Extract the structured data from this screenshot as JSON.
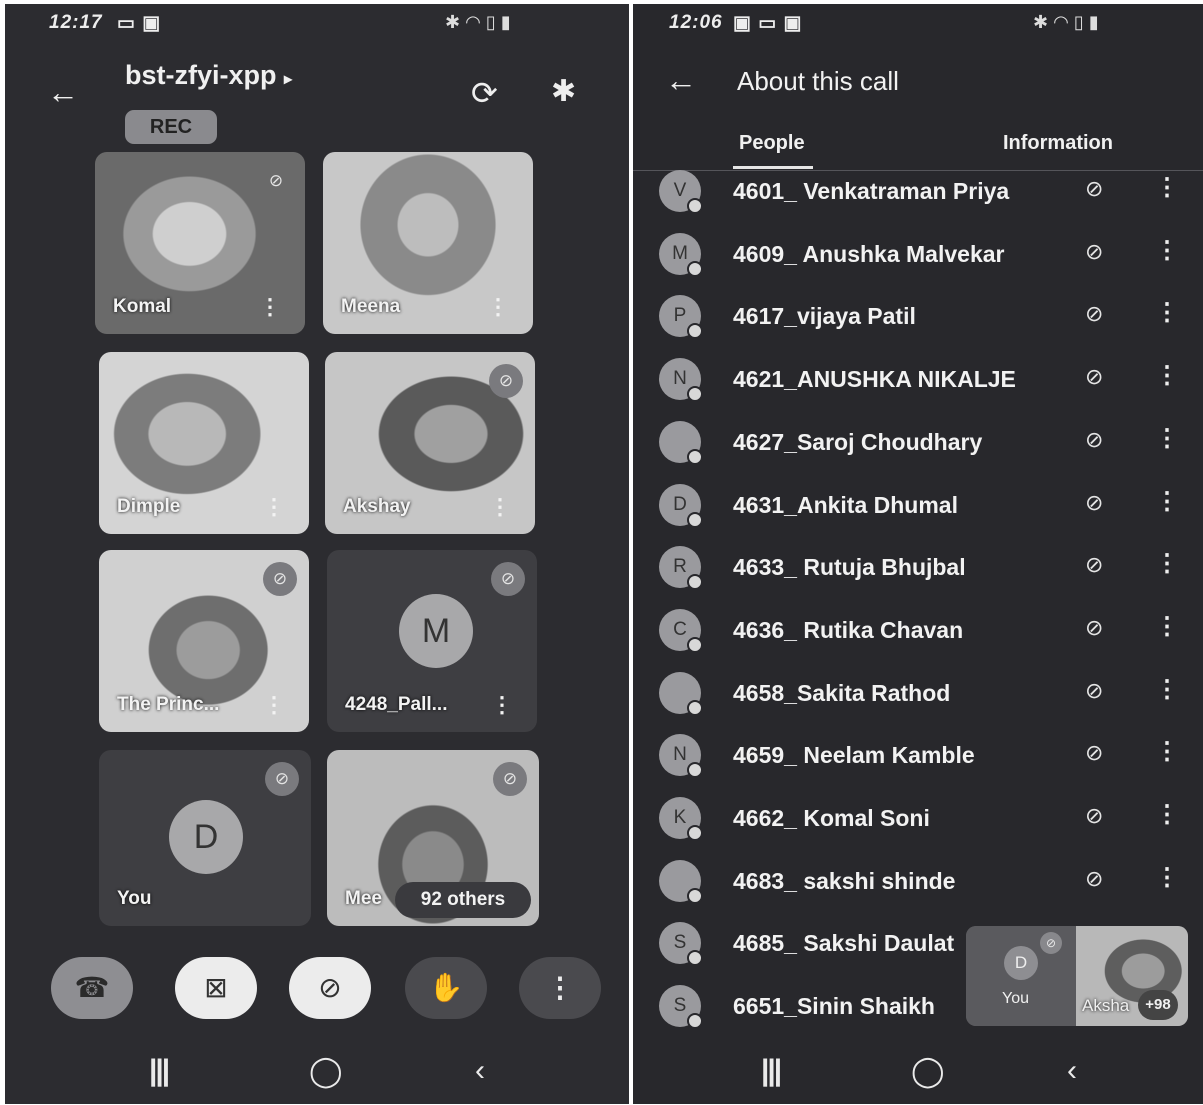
{
  "left": {
    "status_time": "12:17",
    "meeting_code": "bst-zfyi-xpp",
    "rec_label": "REC",
    "tiles": [
      {
        "name": "Komal"
      },
      {
        "name": "Meena"
      },
      {
        "name": "Dimple"
      },
      {
        "name": "Akshay"
      },
      {
        "name": "The Princ...",
        "muted": true
      },
      {
        "name": "4248_Pall...",
        "initial": "M",
        "muted": true
      },
      {
        "name": "You",
        "initial": "D",
        "muted": true
      },
      {
        "name": "Mee",
        "others": "92 others",
        "muted": true
      }
    ]
  },
  "right": {
    "status_time": "12:06",
    "header_title": "About this call",
    "tabs": [
      "People",
      "Information"
    ],
    "people": [
      {
        "name": "4601_ Venkatraman Priya",
        "initial": "V"
      },
      {
        "name": "4609_ Anushka Malvekar",
        "initial": "M"
      },
      {
        "name": "4617_vijaya Patil",
        "initial": "P"
      },
      {
        "name": "4621_ANUSHKA NIKALJE",
        "initial": "N"
      },
      {
        "name": "4627_Saroj Choudhary",
        "initial": ""
      },
      {
        "name": "4631_Ankita Dhumal",
        "initial": "D"
      },
      {
        "name": "4633_ Rutuja Bhujbal",
        "initial": "R"
      },
      {
        "name": "4636_ Rutika Chavan",
        "initial": "C"
      },
      {
        "name": "4658_Sakita Rathod",
        "initial": ""
      },
      {
        "name": "4659_ Neelam Kamble",
        "initial": "N"
      },
      {
        "name": "4662_ Komal Soni",
        "initial": "K"
      },
      {
        "name": "4683_ sakshi shinde",
        "initial": ""
      },
      {
        "name": "4685_ Sakshi Daulat",
        "initial": "S"
      },
      {
        "name": "6651_Sinin Shaikh",
        "initial": "S"
      }
    ],
    "pip": {
      "you_initial": "D",
      "you_label": "You",
      "other_label": "Aksha",
      "count": "+98"
    }
  }
}
